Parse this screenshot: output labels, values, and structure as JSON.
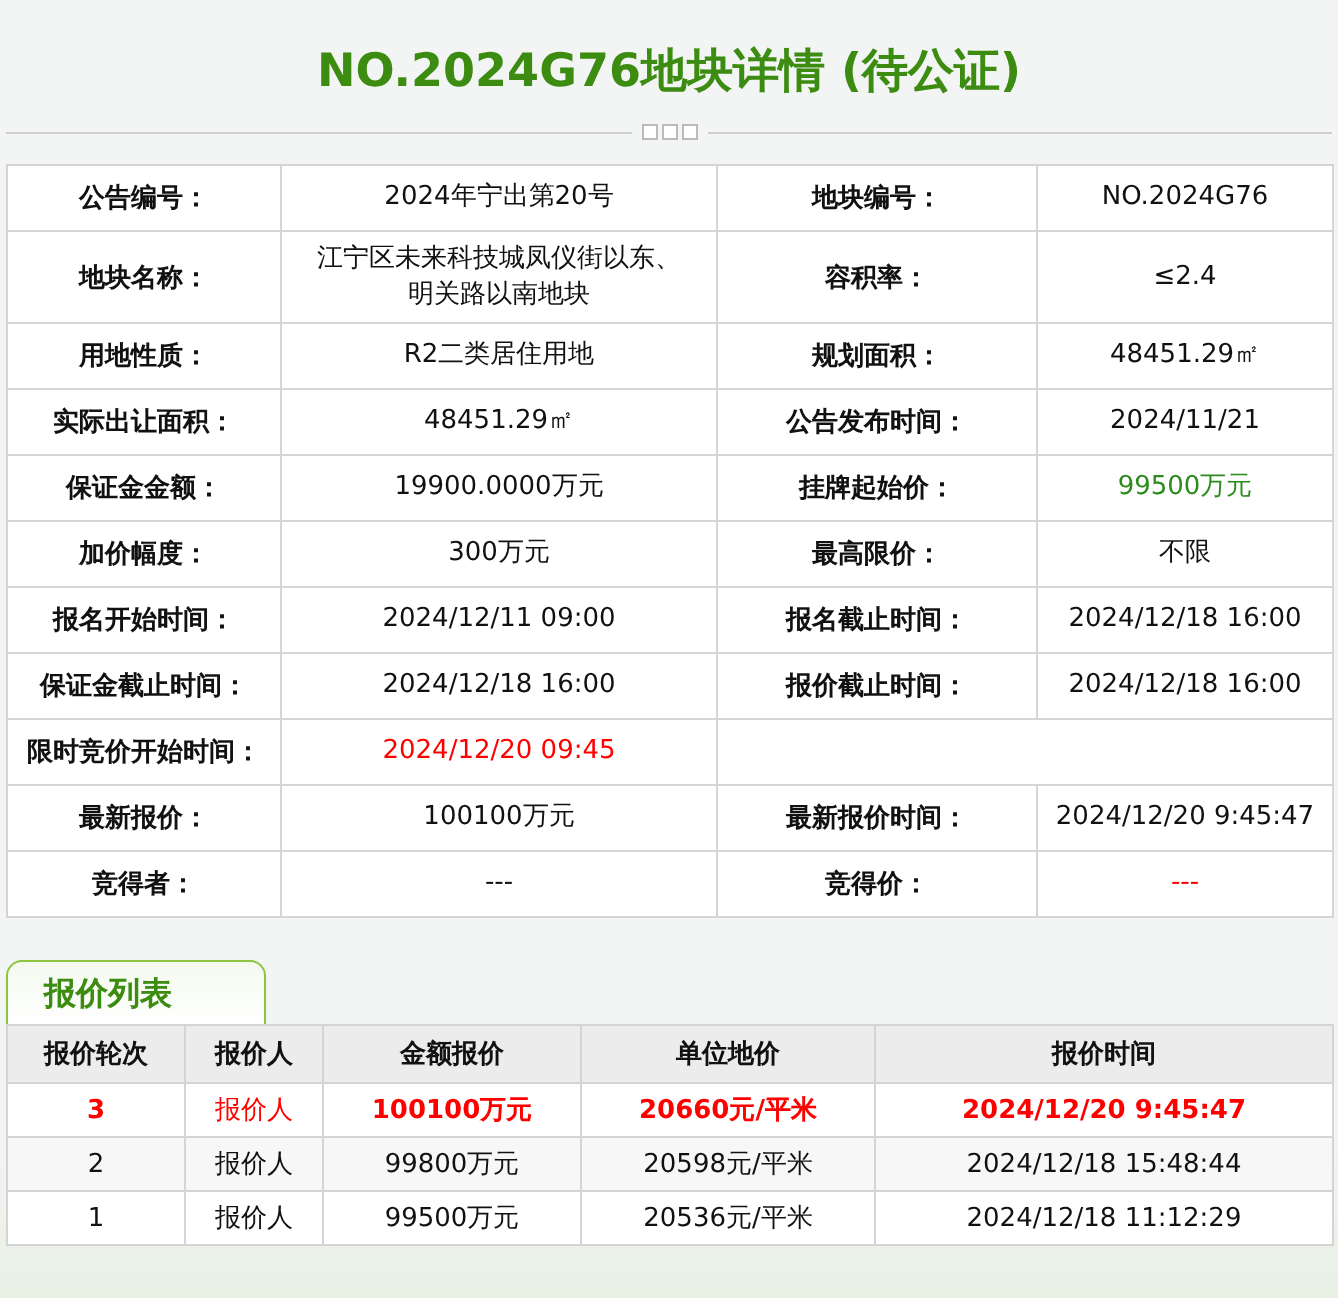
{
  "title": "NO.2024G76地块详情 (待公证)",
  "details": [
    [
      {
        "label": "公告编号：",
        "value": "2024年宁出第20号"
      },
      {
        "label": "地块编号：",
        "value": "NO.2024G76"
      }
    ],
    [
      {
        "label": "地块名称：",
        "value": "江宁区未来科技城凤仪街以东、明关路以南地块"
      },
      {
        "label": "容积率：",
        "value": "≤2.4"
      }
    ],
    [
      {
        "label": "用地性质：",
        "value": "R2二类居住用地"
      },
      {
        "label": "规划面积：",
        "value": "48451.29㎡"
      }
    ],
    [
      {
        "label": "实际出让面积：",
        "value": "48451.29㎡"
      },
      {
        "label": "公告发布时间：",
        "value": "2024/11/21"
      }
    ],
    [
      {
        "label": "保证金金额：",
        "value": "19900.0000万元"
      },
      {
        "label": "挂牌起始价：",
        "value": "99500万元",
        "color": "#2e8b1e"
      }
    ],
    [
      {
        "label": "加价幅度：",
        "value": "300万元"
      },
      {
        "label": "最高限价：",
        "value": "不限"
      }
    ],
    [
      {
        "label": "报名开始时间：",
        "value": "2024/12/11 09:00"
      },
      {
        "label": "报名截止时间：",
        "value": "2024/12/18 16:00"
      }
    ],
    [
      {
        "label": "保证金截止时间：",
        "value": "2024/12/18 16:00"
      },
      {
        "label": "报价截止时间：",
        "value": "2024/12/18 16:00"
      }
    ],
    [
      {
        "label": "限时竞价开始时间：",
        "value": "2024/12/20 09:45",
        "color": "#ff0000"
      }
    ],
    [
      {
        "label": "最新报价：",
        "value": "100100万元"
      },
      {
        "label": "最新报价时间：",
        "value": "2024/12/20 9:45:47"
      }
    ],
    [
      {
        "label": "竞得者：",
        "value": "---"
      },
      {
        "label": "竞得价：",
        "value": "---",
        "color": "#ff0000"
      }
    ]
  ],
  "bids_tab": {
    "label": "报价列表",
    "selected": true
  },
  "bids": {
    "columns": [
      "报价轮次",
      "报价人",
      "金额报价",
      "单位地价",
      "报价时间"
    ],
    "rows": [
      {
        "highlighted": true,
        "cells": [
          "3",
          "报价人",
          "100100万元",
          "20660元/平米",
          "2024/12/20 9:45:47"
        ]
      },
      {
        "highlighted": false,
        "cells": [
          "2",
          "报价人",
          "99800万元",
          "20598元/平米",
          "2024/12/18 15:48:44"
        ]
      },
      {
        "highlighted": false,
        "cells": [
          "1",
          "报价人",
          "99500万元",
          "20536元/平米",
          "2024/12/18 11:12:29"
        ]
      }
    ]
  }
}
